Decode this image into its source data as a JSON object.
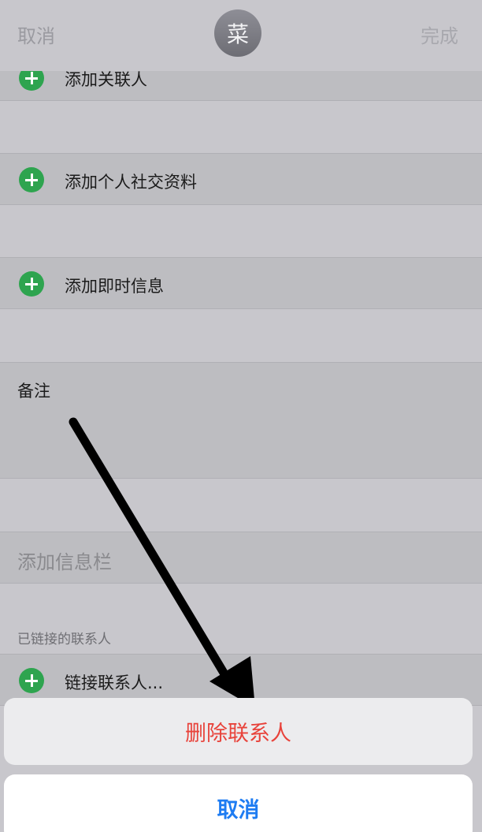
{
  "nav": {
    "cancel_label": "取消",
    "avatar_initial": "菜",
    "done_label": "完成"
  },
  "rows": {
    "add_related": "添加关联人",
    "add_social": "添加个人社交资料",
    "add_im": "添加即时信息",
    "notes": "备注",
    "add_field": "添加信息栏",
    "linked_header": "已链接的联系人",
    "link_contact": "链接联系人..."
  },
  "action_sheet": {
    "delete_label": "删除联系人",
    "cancel_label": "取消"
  },
  "colors": {
    "plus_green": "#2ea44f",
    "destructive_red": "#e8433b",
    "ios_blue": "#1e7cf2"
  }
}
